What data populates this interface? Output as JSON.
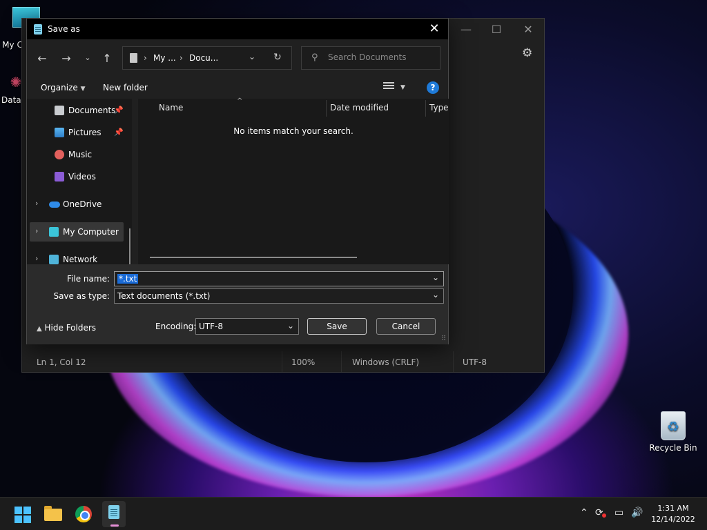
{
  "desktop": {
    "icons": {
      "my_computer": "My C",
      "dataw": "DataW",
      "recycle_bin": "Recycle Bin"
    }
  },
  "notepad": {
    "status": {
      "position": "Ln 1, Col 12",
      "zoom": "100%",
      "line_ending": "Windows (CRLF)",
      "encoding": "UTF-8"
    }
  },
  "dialog": {
    "title": "Save as",
    "address": {
      "crumb1": "My ...",
      "crumb2": "Docu..."
    },
    "search_placeholder": "Search Documents",
    "toolbar": {
      "organize": "Organize",
      "new_folder": "New folder"
    },
    "nav": {
      "documents": "Documents",
      "pictures": "Pictures",
      "music": "Music",
      "videos": "Videos",
      "onedrive": "OneDrive",
      "my_computer": "My Computer",
      "network": "Network"
    },
    "columns": {
      "name": "Name",
      "date_modified": "Date modified",
      "type": "Type"
    },
    "empty_message": "No items match your search.",
    "file_name_label": "File name:",
    "file_name_value": "*.txt",
    "save_type_label": "Save as type:",
    "save_type_value": "Text documents (*.txt)",
    "hide_folders": "Hide Folders",
    "encoding_label": "Encoding:",
    "encoding_value": "UTF-8",
    "save_button": "Save",
    "cancel_button": "Cancel"
  },
  "taskbar": {
    "time": "1:31 AM",
    "date": "12/14/2022"
  },
  "colors": {
    "accent": "#1a6bd6",
    "dialog_bg": "#202020",
    "taskbar_bg": "#1c1c1c"
  }
}
